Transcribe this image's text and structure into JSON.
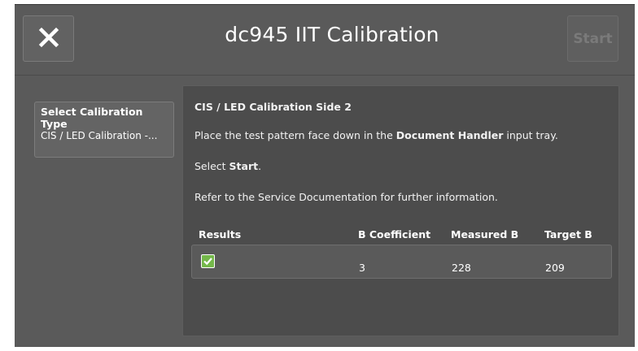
{
  "header": {
    "title": "dc945 IIT Calibration",
    "start_label": "Start"
  },
  "calibration_type": {
    "label": "Select Calibration Type",
    "value": "CIS / LED Calibration -..."
  },
  "panel": {
    "heading": "CIS / LED Calibration Side 2",
    "instruction_prefix": "Place the test pattern face down in the ",
    "instruction_bold": "Document Handler",
    "instruction_suffix": " input tray.",
    "select_prefix": "Select ",
    "select_bold": "Start",
    "select_suffix": ".",
    "refer": "Refer to the Service Documentation for further information."
  },
  "results": {
    "columns": [
      "Results",
      "B Coefficient",
      "Measured B",
      "Target B"
    ],
    "rows": [
      {
        "status": "check",
        "b_coefficient": "3",
        "measured_b": "228",
        "target_b": "209"
      }
    ]
  },
  "colors": {
    "screen_bg": "#5a5a5a",
    "panel_bg": "#4c4c4c",
    "success": "#74b84a"
  }
}
